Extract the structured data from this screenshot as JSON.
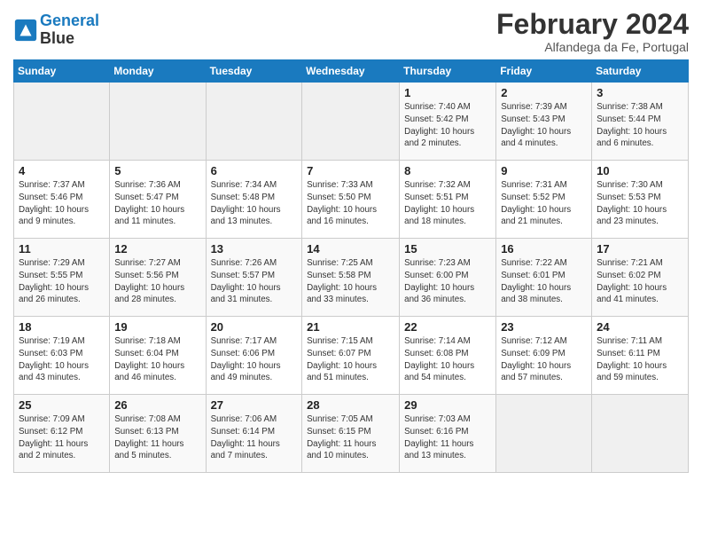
{
  "header": {
    "logo_line1": "General",
    "logo_line2": "Blue",
    "title": "February 2024",
    "subtitle": "Alfandega da Fe, Portugal"
  },
  "weekdays": [
    "Sunday",
    "Monday",
    "Tuesday",
    "Wednesday",
    "Thursday",
    "Friday",
    "Saturday"
  ],
  "weeks": [
    [
      {
        "day": "",
        "info": ""
      },
      {
        "day": "",
        "info": ""
      },
      {
        "day": "",
        "info": ""
      },
      {
        "day": "",
        "info": ""
      },
      {
        "day": "1",
        "info": "Sunrise: 7:40 AM\nSunset: 5:42 PM\nDaylight: 10 hours\nand 2 minutes."
      },
      {
        "day": "2",
        "info": "Sunrise: 7:39 AM\nSunset: 5:43 PM\nDaylight: 10 hours\nand 4 minutes."
      },
      {
        "day": "3",
        "info": "Sunrise: 7:38 AM\nSunset: 5:44 PM\nDaylight: 10 hours\nand 6 minutes."
      }
    ],
    [
      {
        "day": "4",
        "info": "Sunrise: 7:37 AM\nSunset: 5:46 PM\nDaylight: 10 hours\nand 9 minutes."
      },
      {
        "day": "5",
        "info": "Sunrise: 7:36 AM\nSunset: 5:47 PM\nDaylight: 10 hours\nand 11 minutes."
      },
      {
        "day": "6",
        "info": "Sunrise: 7:34 AM\nSunset: 5:48 PM\nDaylight: 10 hours\nand 13 minutes."
      },
      {
        "day": "7",
        "info": "Sunrise: 7:33 AM\nSunset: 5:50 PM\nDaylight: 10 hours\nand 16 minutes."
      },
      {
        "day": "8",
        "info": "Sunrise: 7:32 AM\nSunset: 5:51 PM\nDaylight: 10 hours\nand 18 minutes."
      },
      {
        "day": "9",
        "info": "Sunrise: 7:31 AM\nSunset: 5:52 PM\nDaylight: 10 hours\nand 21 minutes."
      },
      {
        "day": "10",
        "info": "Sunrise: 7:30 AM\nSunset: 5:53 PM\nDaylight: 10 hours\nand 23 minutes."
      }
    ],
    [
      {
        "day": "11",
        "info": "Sunrise: 7:29 AM\nSunset: 5:55 PM\nDaylight: 10 hours\nand 26 minutes."
      },
      {
        "day": "12",
        "info": "Sunrise: 7:27 AM\nSunset: 5:56 PM\nDaylight: 10 hours\nand 28 minutes."
      },
      {
        "day": "13",
        "info": "Sunrise: 7:26 AM\nSunset: 5:57 PM\nDaylight: 10 hours\nand 31 minutes."
      },
      {
        "day": "14",
        "info": "Sunrise: 7:25 AM\nSunset: 5:58 PM\nDaylight: 10 hours\nand 33 minutes."
      },
      {
        "day": "15",
        "info": "Sunrise: 7:23 AM\nSunset: 6:00 PM\nDaylight: 10 hours\nand 36 minutes."
      },
      {
        "day": "16",
        "info": "Sunrise: 7:22 AM\nSunset: 6:01 PM\nDaylight: 10 hours\nand 38 minutes."
      },
      {
        "day": "17",
        "info": "Sunrise: 7:21 AM\nSunset: 6:02 PM\nDaylight: 10 hours\nand 41 minutes."
      }
    ],
    [
      {
        "day": "18",
        "info": "Sunrise: 7:19 AM\nSunset: 6:03 PM\nDaylight: 10 hours\nand 43 minutes."
      },
      {
        "day": "19",
        "info": "Sunrise: 7:18 AM\nSunset: 6:04 PM\nDaylight: 10 hours\nand 46 minutes."
      },
      {
        "day": "20",
        "info": "Sunrise: 7:17 AM\nSunset: 6:06 PM\nDaylight: 10 hours\nand 49 minutes."
      },
      {
        "day": "21",
        "info": "Sunrise: 7:15 AM\nSunset: 6:07 PM\nDaylight: 10 hours\nand 51 minutes."
      },
      {
        "day": "22",
        "info": "Sunrise: 7:14 AM\nSunset: 6:08 PM\nDaylight: 10 hours\nand 54 minutes."
      },
      {
        "day": "23",
        "info": "Sunrise: 7:12 AM\nSunset: 6:09 PM\nDaylight: 10 hours\nand 57 minutes."
      },
      {
        "day": "24",
        "info": "Sunrise: 7:11 AM\nSunset: 6:11 PM\nDaylight: 10 hours\nand 59 minutes."
      }
    ],
    [
      {
        "day": "25",
        "info": "Sunrise: 7:09 AM\nSunset: 6:12 PM\nDaylight: 11 hours\nand 2 minutes."
      },
      {
        "day": "26",
        "info": "Sunrise: 7:08 AM\nSunset: 6:13 PM\nDaylight: 11 hours\nand 5 minutes."
      },
      {
        "day": "27",
        "info": "Sunrise: 7:06 AM\nSunset: 6:14 PM\nDaylight: 11 hours\nand 7 minutes."
      },
      {
        "day": "28",
        "info": "Sunrise: 7:05 AM\nSunset: 6:15 PM\nDaylight: 11 hours\nand 10 minutes."
      },
      {
        "day": "29",
        "info": "Sunrise: 7:03 AM\nSunset: 6:16 PM\nDaylight: 11 hours\nand 13 minutes."
      },
      {
        "day": "",
        "info": ""
      },
      {
        "day": "",
        "info": ""
      }
    ]
  ]
}
